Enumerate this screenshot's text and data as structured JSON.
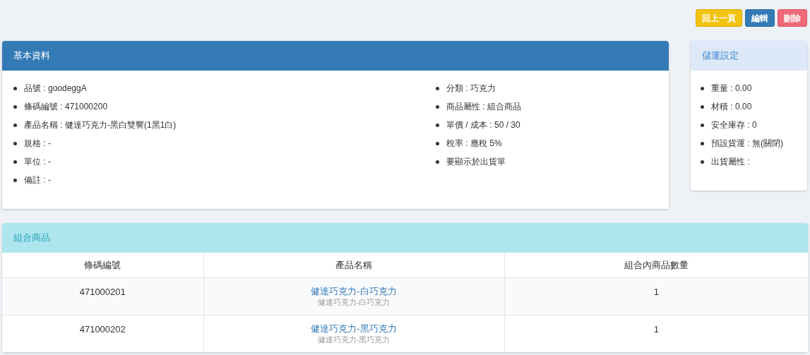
{
  "actions": [
    {
      "label": "回上一頁",
      "kind": "back"
    },
    {
      "label": "編輯",
      "kind": "edit"
    },
    {
      "label": "刪除",
      "kind": "delete"
    }
  ],
  "basic_info": {
    "title": "基本資料",
    "left_items": [
      "品號 : goodeggA",
      "條碼編號 : 471000200",
      "產品名稱 : 健達巧克力-黑白雙響(1黑1白)",
      "規格 : -",
      "單位 : -",
      "備註 : -"
    ],
    "right_items": [
      "分類 : 巧克力",
      "商品屬性 : 組合商品",
      "單價 / 成本 : 50 / 30",
      "稅率 : 應稅 5%",
      "要顯示於出貨單"
    ]
  },
  "shipping_settings": {
    "title": "儲運設定",
    "items": [
      "重量 : 0.00",
      "材積 : 0.00",
      "安全庫存 : 0",
      "預設貨運 : 無(關閉)",
      "出貨屬性 :"
    ]
  },
  "bundle": {
    "title": "組合商品",
    "columns": [
      "條碼編號",
      "產品名稱",
      "組合內商品數量"
    ],
    "rows": [
      {
        "barcode": "471000201",
        "name": "健達巧克力-白巧克力",
        "subname": "健達巧克力-白巧克力",
        "quantity": "1"
      },
      {
        "barcode": "471000202",
        "name": "健達巧克力-黑巧克力",
        "subname": "健達巧克力-黑巧克力",
        "quantity": "1"
      }
    ]
  }
}
